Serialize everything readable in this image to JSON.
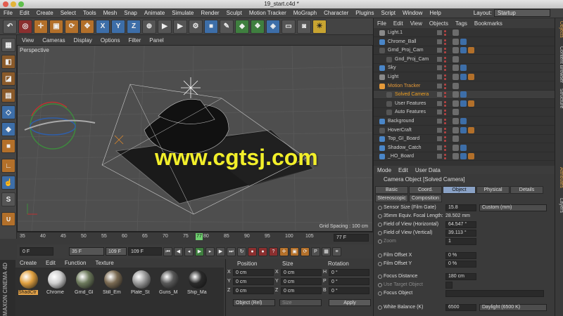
{
  "window": {
    "title": "19_start.c4d *"
  },
  "menu": [
    "File",
    "Edit",
    "Create",
    "Select",
    "Tools",
    "Mesh",
    "Snap",
    "Animate",
    "Simulate",
    "Render",
    "Sculpt",
    "Motion Tracker",
    "MoGraph",
    "Character",
    "Plugins",
    "Script",
    "Window",
    "Help"
  ],
  "layout": {
    "label": "Layout:",
    "value": "Startup"
  },
  "toolbar": {
    "x": "X",
    "y": "Y",
    "z": "Z"
  },
  "viewport": {
    "menu": [
      "View",
      "Cameras",
      "Display",
      "Options",
      "Filter",
      "Panel"
    ],
    "name": "Perspective",
    "grid_spacing": "Grid Spacing : 100 cm"
  },
  "timeline": {
    "ticks": [
      "35",
      "40",
      "45",
      "50",
      "55",
      "60",
      "65",
      "70",
      "75",
      "80",
      "85",
      "90",
      "95",
      "100",
      "105"
    ],
    "current": "77",
    "frame_field": "77 F"
  },
  "playback": {
    "start": "0 F",
    "range_a": "35 F",
    "range_b": "109 F",
    "end": "109 F"
  },
  "materials": {
    "menu": [
      "Create",
      "Edit",
      "Function",
      "Texture"
    ],
    "items": [
      {
        "label": "ShadCtr",
        "color": "#e0a040"
      },
      {
        "label": "Chrome",
        "color": "#cfcfcf"
      },
      {
        "label": "Grnd_Gl",
        "color": "#6d7a5c"
      },
      {
        "label": "Still_Em",
        "color": "#7a6a52"
      },
      {
        "label": "Plate_St",
        "color": "#9a9a9a"
      },
      {
        "label": "Guns_M",
        "color": "#585858"
      },
      {
        "label": "Ship_Ma",
        "color": "#2a2a2a"
      }
    ]
  },
  "coords": {
    "headers": [
      "Position",
      "Size",
      "Rotation"
    ],
    "rows": [
      {
        "axis": "X",
        "pos": "0 cm",
        "size_axis": "X",
        "size": "0 cm",
        "rot_axis": "H",
        "rot": "0 °"
      },
      {
        "axis": "Y",
        "pos": "0 cm",
        "size_axis": "Y",
        "size": "0 cm",
        "rot_axis": "P",
        "rot": "0 °"
      },
      {
        "axis": "Z",
        "pos": "0 cm",
        "size_axis": "Z",
        "size": "0 cm",
        "rot_axis": "B",
        "rot": "0 °"
      }
    ],
    "mode": "Object (Rel)",
    "size_mode": "Size",
    "apply": "Apply"
  },
  "objects": {
    "menu": [
      "File",
      "Edit",
      "View",
      "Objects",
      "Tags",
      "Bookmarks"
    ],
    "items": [
      {
        "name": "Light.1",
        "indent": 0,
        "color": "#cfcfcf",
        "icon": "#8a8a8a"
      },
      {
        "name": "Chrome_Ball",
        "indent": 0,
        "color": "#cfcfcf",
        "icon": "#4a86c8"
      },
      {
        "name": "Grnd_Proj_Cam",
        "indent": 0,
        "color": "#cfcfcf",
        "icon": "#555"
      },
      {
        "name": "Gnd_Proj_Cam",
        "indent": 1,
        "color": "#cfcfcf",
        "icon": "#555"
      },
      {
        "name": "Sky",
        "indent": 0,
        "color": "#cfcfcf",
        "icon": "#4a86c8"
      },
      {
        "name": "Light",
        "indent": 0,
        "color": "#cfcfcf",
        "icon": "#8a8a8a"
      },
      {
        "name": "Motion Tracker",
        "indent": 0,
        "color": "#e59a3a",
        "icon": "#e59a3a"
      },
      {
        "name": "Solved Camera",
        "indent": 1,
        "color": "#f0a020",
        "icon": "#555"
      },
      {
        "name": "User Features",
        "indent": 1,
        "color": "#cfcfcf",
        "icon": "#555"
      },
      {
        "name": "Auto Features",
        "indent": 1,
        "color": "#cfcfcf",
        "icon": "#555"
      },
      {
        "name": "Background",
        "indent": 0,
        "color": "#cfcfcf",
        "icon": "#4a86c8"
      },
      {
        "name": "HoverCraft",
        "indent": 0,
        "color": "#cfcfcf",
        "icon": "#555"
      },
      {
        "name": "Top_GI_Board",
        "indent": 0,
        "color": "#cfcfcf",
        "icon": "#4a86c8"
      },
      {
        "name": "Shadow_Catch",
        "indent": 0,
        "color": "#cfcfcf",
        "icon": "#4a86c8"
      },
      {
        "name": "_HO_Board",
        "indent": 0,
        "color": "#cfcfcf",
        "icon": "#4a86c8"
      }
    ]
  },
  "attributes": {
    "menu": [
      "Mode",
      "Edit",
      "User Data"
    ],
    "title": "Camera Object [Solved Camera]",
    "tabs": [
      "Basic",
      "Coord.",
      "Object",
      "Physical",
      "Details"
    ],
    "tabs2": [
      "Stereoscopic",
      "Composition"
    ],
    "active_tab": "Object",
    "fields": [
      {
        "label": "Sensor Size (Film Gate)",
        "value": "15.8",
        "extra": "Custom (mm)"
      },
      {
        "label": "35mm Equiv. Focal Length:",
        "value": "28.502 mm",
        "extra": ""
      },
      {
        "label": "Field of View (Horizontal)",
        "value": "64.547 °",
        "extra": ""
      },
      {
        "label": "Field of View (Vertical)",
        "value": "39.113 °",
        "extra": ""
      },
      {
        "label": "Zoom",
        "value": "1",
        "extra": ""
      },
      {
        "label": "Film Offset X",
        "value": "0 %",
        "extra": ""
      },
      {
        "label": "Film Offset Y",
        "value": "0 %",
        "extra": ""
      },
      {
        "label": "Focus Distance",
        "value": "180 cm",
        "extra": ""
      },
      {
        "label": "Use Target Object",
        "value": "",
        "extra": ""
      },
      {
        "label": "Focus Object",
        "value": "",
        "extra": ""
      },
      {
        "label": "White Balance (K)",
        "value": "6500",
        "extra": "Daylight (6500 K)"
      }
    ]
  },
  "side_tabs": [
    "Objects",
    "Content Browser",
    "Structure",
    "Attributes",
    "Layers"
  ],
  "watermark": "www.cgtsj.com",
  "brand": "MAXON CINEMA 4D"
}
